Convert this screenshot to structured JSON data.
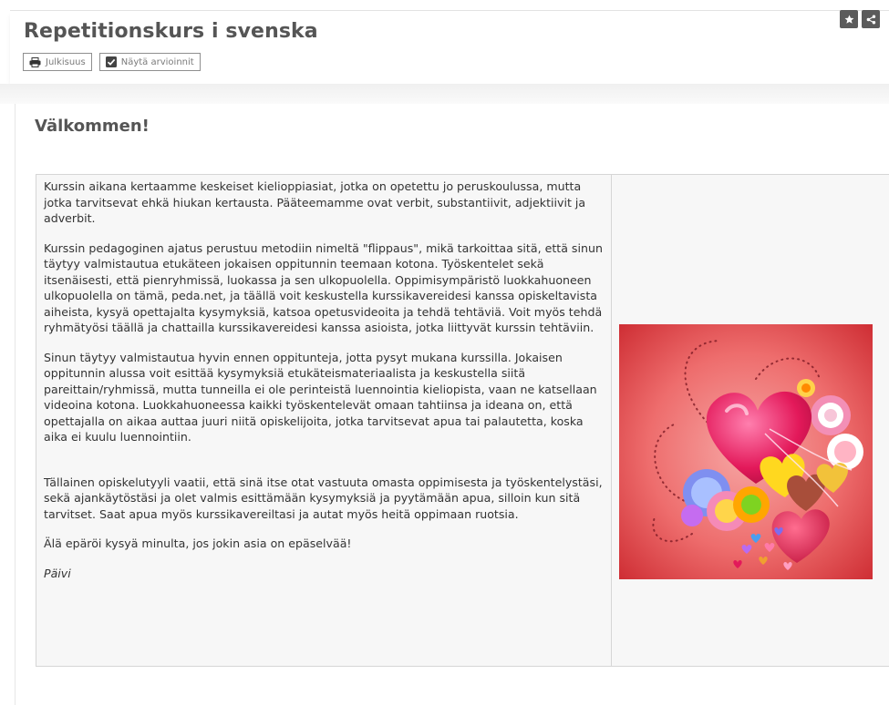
{
  "header": {
    "title": "Repetitionskurs i svenska",
    "buttons": {
      "publish_label": "Julkisuus",
      "show_grades_label": "Näytä arvioinnit"
    },
    "icons": [
      "star-icon",
      "share-icon"
    ]
  },
  "content": {
    "heading": "Välkommen!",
    "paragraphs": [
      "Kurssin aikana kertaamme keskeiset kielioppiasiat, jotka on opetettu jo peruskoulussa, mutta jotka tarvitsevat ehkä hiukan kertausta. Pääteemamme ovat verbit, substantiivit, adjektiivit ja adverbit.",
      "Kurssin pedagoginen ajatus perustuu metodiin nimeltä \"flippaus\", mikä tarkoittaa sitä, että sinun täytyy valmistautua etukäteen jokaisen oppitunnin teemaan kotona. Työskentelet sekä itsenäisesti, että pienryhmissä, luokassa ja sen ulkopuolella. Oppimisympäristö luokkahuoneen ulkopuolella on tämä, peda.net, ja täällä voit keskustella kurssikavereidesi kanssa opiskeltavista aiheista, kysyä opettajalta kysymyksiä, katsoa opetusvideoita ja tehdä tehtäviä. Voit myös tehdä ryhmätyösi täällä ja chattailla kurssikavereidesi kanssa asioista, jotka liittyvät kurssin tehtäviin.",
      "Sinun täytyy valmistautua hyvin ennen oppitunteja, jotta pysyt mukana kurssilla. Jokaisen oppitunnin alussa voit esittää kysymyksiä etukäteismateriaalista ja keskustella siitä pareittain/ryhmissä, mutta tunneilla ei ole perinteistä luennointia kieliopista, vaan ne katsellaan videoina kotona. Luokkahuoneessa kaikki työskentelevät omaan tahtiinsa ja ideana on, että opettajalla on aikaa auttaa juuri niitä opiskelijoita, jotka tarvitsevat apua tai palautetta, koska aika ei kuulu luennointiin.",
      "Tällainen opiskelutyyli vaatii, että sinä itse otat vastuuta omasta oppimisesta ja työskentelystäsi, sekä ajankäytöstäsi ja olet valmis esittämään kysymyksiä ja pyytämään apua, silloin kun sitä tarvitset. Saat apua myös kurssikavereiltasi ja autat myös heitä oppimaan ruotsia.",
      "Älä epäröi kysyä minulta, jos jokin asia on epäselvää!"
    ],
    "signature": "Päivi",
    "image": "colorful-hearts-illustration"
  },
  "colors": {
    "title_gray": "#555555",
    "icon_button_bg": "#5b5b5b",
    "image_red": "#e8494c",
    "heart_pink": "#e3195a"
  }
}
